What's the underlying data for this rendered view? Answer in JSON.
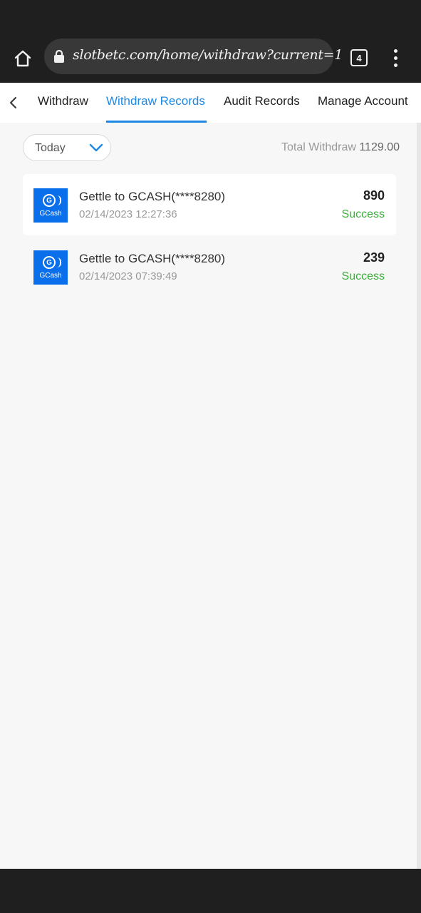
{
  "browser": {
    "url": "slotbetc.com/home/withdraw?current=1",
    "tab_count": "4",
    "icons": {
      "home": "home-icon",
      "lock": "lock-icon",
      "tabs": "tab-switcher-icon",
      "menu": "more-vert-icon"
    }
  },
  "nav": {
    "back_icon": "chevron-left-icon",
    "tabs": [
      {
        "label": "Withdraw",
        "active": false
      },
      {
        "label": "Withdraw Records",
        "active": true
      },
      {
        "label": "Audit Records",
        "active": false
      },
      {
        "label": "Manage Account",
        "active": false
      }
    ]
  },
  "filter": {
    "selected": "Today",
    "icon": "chevron-down-icon"
  },
  "summary": {
    "label": "Total Withdraw",
    "value": "1129.00"
  },
  "records": [
    {
      "logo_text": "GCash",
      "logo_letter": "G",
      "title": "Gettle to GCASH(****8280)",
      "time": "02/14/2023 12:27:36",
      "amount": "890",
      "status": "Success"
    },
    {
      "logo_text": "GCash",
      "logo_letter": "G",
      "title": "Gettle to GCASH(****8280)",
      "time": "02/14/2023 07:39:49",
      "amount": "239",
      "status": "Success"
    }
  ],
  "colors": {
    "accent": "#1e88e5",
    "success": "#3cae3c",
    "gcash_blue": "#0a6fea",
    "browser_chrome": "#1f1f1f",
    "page_bg": "#f7f7f7"
  }
}
